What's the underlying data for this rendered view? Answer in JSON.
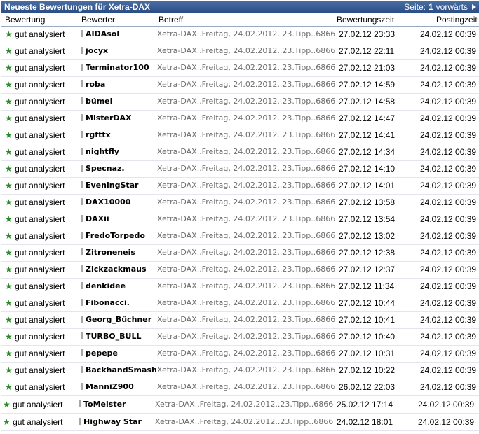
{
  "header": {
    "title": "Neueste Bewertungen für Xetra-DAX",
    "page_label": "Seite:",
    "page_number": "1",
    "next_label": "vorwärts"
  },
  "columns": {
    "rating": "Bewertung",
    "rater": "Bewerter",
    "subject": "Betreff",
    "rating_time": "Bewertungszeit",
    "posting_time": "Postingzeit"
  },
  "rows": [
    {
      "rating": "gut analysiert",
      "rater": "AIDAsol",
      "subject": "Xetra-DAX..Freitag, 24.02.2012..23.Tipp..6866",
      "rating_time": "27.02.12 23:33",
      "posting_time": "24.02.12 00:39"
    },
    {
      "rating": "gut analysiert",
      "rater": "jocyx",
      "subject": "Xetra-DAX..Freitag, 24.02.2012..23.Tipp..6866",
      "rating_time": "27.02.12 22:11",
      "posting_time": "24.02.12 00:39"
    },
    {
      "rating": "gut analysiert",
      "rater": "Terminator100",
      "subject": "Xetra-DAX..Freitag, 24.02.2012..23.Tipp..6866",
      "rating_time": "27.02.12 21:03",
      "posting_time": "24.02.12 00:39"
    },
    {
      "rating": "gut analysiert",
      "rater": "roba",
      "subject": "Xetra-DAX..Freitag, 24.02.2012..23.Tipp..6866",
      "rating_time": "27.02.12 14:59",
      "posting_time": "24.02.12 00:39"
    },
    {
      "rating": "gut analysiert",
      "rater": "bümei",
      "subject": "Xetra-DAX..Freitag, 24.02.2012..23.Tipp..6866",
      "rating_time": "27.02.12 14:58",
      "posting_time": "24.02.12 00:39"
    },
    {
      "rating": "gut analysiert",
      "rater": "MisterDAX",
      "subject": "Xetra-DAX..Freitag, 24.02.2012..23.Tipp..6866",
      "rating_time": "27.02.12 14:47",
      "posting_time": "24.02.12 00:39"
    },
    {
      "rating": "gut analysiert",
      "rater": "rgfttx",
      "subject": "Xetra-DAX..Freitag, 24.02.2012..23.Tipp..6866",
      "rating_time": "27.02.12 14:41",
      "posting_time": "24.02.12 00:39"
    },
    {
      "rating": "gut analysiert",
      "rater": "nightfly",
      "subject": "Xetra-DAX..Freitag, 24.02.2012..23.Tipp..6866",
      "rating_time": "27.02.12 14:34",
      "posting_time": "24.02.12 00:39"
    },
    {
      "rating": "gut analysiert",
      "rater": "Specnaz.",
      "subject": "Xetra-DAX..Freitag, 24.02.2012..23.Tipp..6866",
      "rating_time": "27.02.12 14:10",
      "posting_time": "24.02.12 00:39"
    },
    {
      "rating": "gut analysiert",
      "rater": "EveningStar",
      "subject": "Xetra-DAX..Freitag, 24.02.2012..23.Tipp..6866",
      "rating_time": "27.02.12 14:01",
      "posting_time": "24.02.12 00:39"
    },
    {
      "rating": "gut analysiert",
      "rater": "DAX10000",
      "subject": "Xetra-DAX..Freitag, 24.02.2012..23.Tipp..6866",
      "rating_time": "27.02.12 13:58",
      "posting_time": "24.02.12 00:39"
    },
    {
      "rating": "gut analysiert",
      "rater": "DAXii",
      "subject": "Xetra-DAX..Freitag, 24.02.2012..23.Tipp..6866",
      "rating_time": "27.02.12 13:54",
      "posting_time": "24.02.12 00:39"
    },
    {
      "rating": "gut analysiert",
      "rater": "FredoTorpedo",
      "subject": "Xetra-DAX..Freitag, 24.02.2012..23.Tipp..6866",
      "rating_time": "27.02.12 13:02",
      "posting_time": "24.02.12 00:39"
    },
    {
      "rating": "gut analysiert",
      "rater": "Zitroneneis",
      "subject": "Xetra-DAX..Freitag, 24.02.2012..23.Tipp..6866",
      "rating_time": "27.02.12 12:38",
      "posting_time": "24.02.12 00:39"
    },
    {
      "rating": "gut analysiert",
      "rater": "Zickzackmaus",
      "subject": "Xetra-DAX..Freitag, 24.02.2012..23.Tipp..6866",
      "rating_time": "27.02.12 12:37",
      "posting_time": "24.02.12 00:39"
    },
    {
      "rating": "gut analysiert",
      "rater": "denkidee",
      "subject": "Xetra-DAX..Freitag, 24.02.2012..23.Tipp..6866",
      "rating_time": "27.02.12 11:34",
      "posting_time": "24.02.12 00:39"
    },
    {
      "rating": "gut analysiert",
      "rater": "Fibonacci.",
      "subject": "Xetra-DAX..Freitag, 24.02.2012..23.Tipp..6866",
      "rating_time": "27.02.12 10:44",
      "posting_time": "24.02.12 00:39"
    },
    {
      "rating": "gut analysiert",
      "rater": "Georg_Büchner",
      "subject": "Xetra-DAX..Freitag, 24.02.2012..23.Tipp..6866",
      "rating_time": "27.02.12 10:41",
      "posting_time": "24.02.12 00:39"
    },
    {
      "rating": "gut analysiert",
      "rater": "TURBO_BULL",
      "subject": "Xetra-DAX..Freitag, 24.02.2012..23.Tipp..6866",
      "rating_time": "27.02.12 10:40",
      "posting_time": "24.02.12 00:39"
    },
    {
      "rating": "gut analysiert",
      "rater": "pepepe",
      "subject": "Xetra-DAX..Freitag, 24.02.2012..23.Tipp..6866",
      "rating_time": "27.02.12 10:31",
      "posting_time": "24.02.12 00:39"
    },
    {
      "rating": "gut analysiert",
      "rater": "BackhandSmash",
      "subject": "Xetra-DAX..Freitag, 24.02.2012..23.Tipp..6866",
      "rating_time": "27.02.12 10:22",
      "posting_time": "24.02.12 00:39"
    },
    {
      "rating": "gut analysiert",
      "rater": "ManniZ900",
      "subject": "Xetra-DAX..Freitag, 24.02.2012..23.Tipp..6866",
      "rating_time": "26.02.12 22:03",
      "posting_time": "24.02.12 00:39"
    },
    {
      "rating": "gut analysiert",
      "rater": "ToMeister",
      "subject": "Xetra-DAX..Freitag, 24.02.2012..23.Tipp..6866",
      "rating_time": "25.02.12 17:14",
      "posting_time": "24.02.12 00:39"
    },
    {
      "rating": "gut analysiert",
      "rater": "Highway Star",
      "subject": "Xetra-DAX..Freitag, 24.02.2012..23.Tipp..6866",
      "rating_time": "24.02.12 18:01",
      "posting_time": "24.02.12 00:39"
    }
  ],
  "colors": {
    "header_bg": "#2b4e86",
    "star": "#2a8a2a",
    "subject_text": "#6d6d6d",
    "user_bar": "#a7a7a7"
  }
}
